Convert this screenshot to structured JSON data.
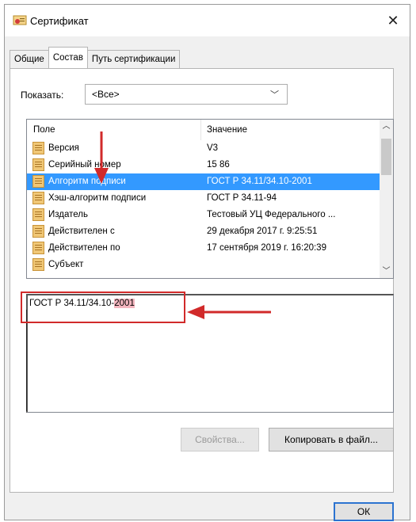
{
  "window": {
    "title": "Сертификат",
    "close_glyph": "✕"
  },
  "tabs": [
    {
      "label": "Общие"
    },
    {
      "label": "Состав"
    },
    {
      "label": "Путь сертификации"
    }
  ],
  "show": {
    "label": "Показать:",
    "value": "<Все>"
  },
  "fields": {
    "header_field": "Поле",
    "header_value": "Значение",
    "rows": [
      {
        "name": "Версия",
        "value": "V3"
      },
      {
        "name": "Серийный номер",
        "value": "15 86"
      },
      {
        "name": "Алгоритм подписи",
        "value": "ГОСТ Р 34.11/34.10-2001"
      },
      {
        "name": "Хэш-алгоритм подписи",
        "value": "ГОСТ Р 34.11-94"
      },
      {
        "name": "Издатель",
        "value": "Тестовый УЦ Федерального ..."
      },
      {
        "name": "Действителен с",
        "value": "29 декабря 2017 г. 9:25:51"
      },
      {
        "name": "Действителен по",
        "value": "17 сентября 2019 г. 16:20:39"
      },
      {
        "name": "Субъект",
        "value": ""
      }
    ],
    "selected_index": 2
  },
  "detail": {
    "text_prefix": "ГОСТ Р 34.11/34.10-",
    "text_selected": "2001"
  },
  "buttons": {
    "properties": "Свойства...",
    "copy_to_file": "Копировать в файл...",
    "ok": "ОК"
  },
  "colors": {
    "selection": "#3399ff",
    "annotation": "#d12a2a"
  }
}
